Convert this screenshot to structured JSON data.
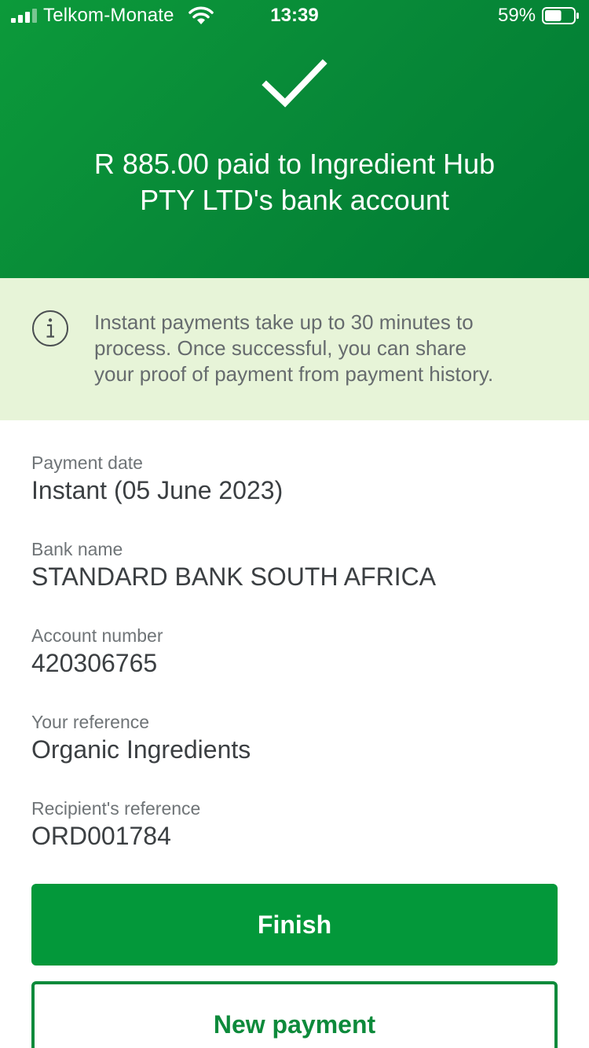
{
  "status_bar": {
    "carrier": "Telkom-Monate",
    "time": "13:39",
    "battery_percent": "59%",
    "battery_level": 0.59,
    "icons": [
      "signal-icon",
      "wifi-icon",
      "battery-icon"
    ]
  },
  "header": {
    "icon": "checkmark-icon",
    "line1": "R 885.00 paid to Ingredient Hub",
    "line2": "PTY LTD's bank account"
  },
  "notice": {
    "icon": "info-icon",
    "line1": "Instant payments take up to 30 minutes to",
    "line2": "process. Once successful, you can share",
    "line3": "your proof of payment from payment history."
  },
  "details": [
    {
      "label": "Payment date",
      "value": "Instant (05 June 2023)"
    },
    {
      "label": "Bank name",
      "value": "STANDARD BANK SOUTH AFRICA"
    },
    {
      "label": "Account number",
      "value": "420306765"
    },
    {
      "label": "Your reference",
      "value": "Organic Ingredients"
    },
    {
      "label": "Recipient's reference",
      "value": "ORD001784"
    }
  ],
  "buttons": {
    "finish": "Finish",
    "new_payment": "New payment"
  },
  "colors": {
    "brand_green": "#03983a",
    "header_green": "#088a38",
    "notice_bg": "#e7f4d8"
  }
}
